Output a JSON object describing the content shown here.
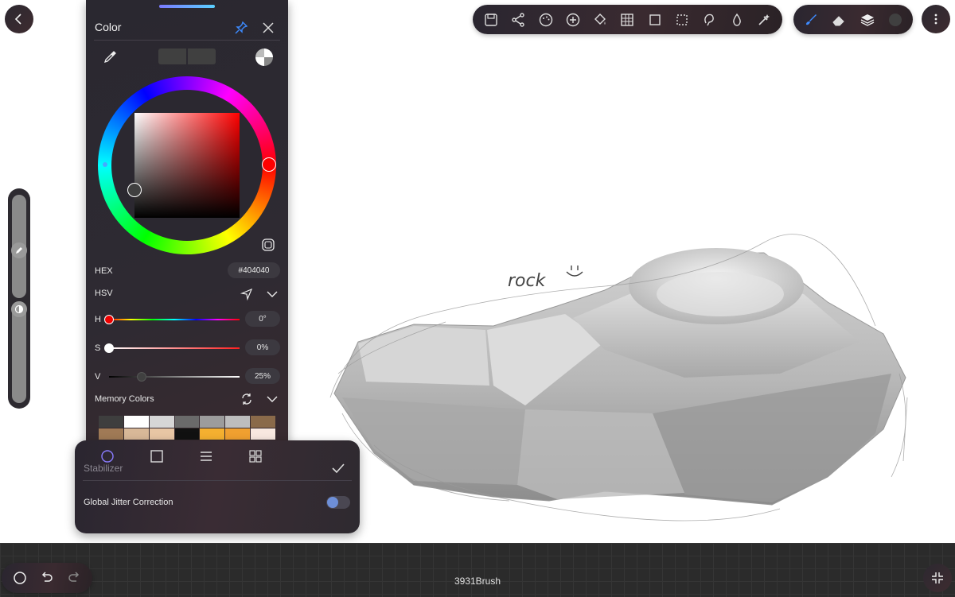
{
  "color_panel": {
    "title": "Color",
    "hex_label": "HEX",
    "hex_value": "#404040",
    "mode_label": "HSV",
    "h_label": "H",
    "h_value": "0°",
    "s_label": "S",
    "s_value": "0%",
    "v_label": "V",
    "v_value": "25%",
    "memory_label": "Memory Colors",
    "memory_colors_row1": [
      "#3e3e3e",
      "#ffffff",
      "#d6d6d6",
      "#6a6a6a",
      "#9c9c9c",
      "#bdbdbd",
      "#8a6a4a"
    ],
    "memory_colors_row2": [
      "#a07a56",
      "#d8b898",
      "#e8c6a4",
      "#111111",
      "#f4b030",
      "#f0a030",
      "#f8e8e0"
    ]
  },
  "stabilizer": {
    "header_label": "Stabilizer",
    "jitter_label": "Global Jitter Correction"
  },
  "canvas": {
    "annotation_text": "rock"
  },
  "bottom": {
    "brush_name": "3931Brush"
  },
  "colors": {
    "accent_blue": "#3d8bff",
    "panel_bg": "#2a2830"
  }
}
